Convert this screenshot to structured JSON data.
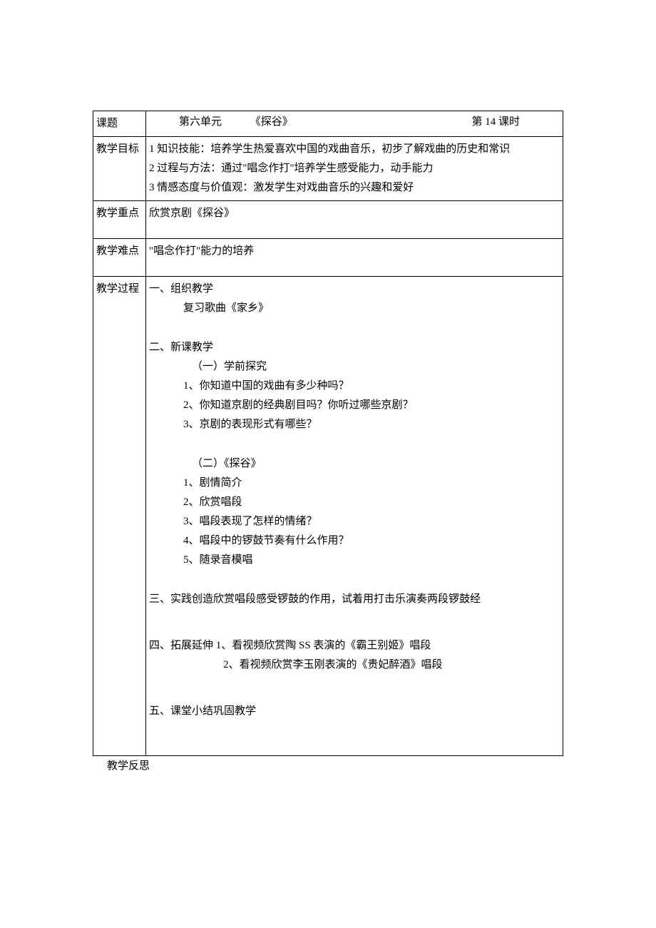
{
  "title_row": {
    "label": "课题",
    "unit": "第六单元",
    "piece": "《探谷》",
    "period": "第 14 课时"
  },
  "objectives": {
    "label": "教学目标",
    "o1": "1 知识技能：培养学生热爱喜欢中国的戏曲音乐，初步了解戏曲的历史和常识",
    "o2": "2 过程与方法：通过\"唱念作打\"培养学生感受能力，动手能力",
    "o3": "3 情感态度与价值观：激发学生对戏曲音乐的兴趣和爱好"
  },
  "key_point": {
    "label": "教学重点",
    "text": "欣赏京剧《探谷》"
  },
  "difficulty": {
    "label": "教学难点",
    "text": "\"唱念作打\"能力的培养"
  },
  "process": {
    "label": "教学过程",
    "s1": {
      "title": "一、组织教学",
      "l1": "复习歌曲《家乡》"
    },
    "s2": {
      "title": "二、新课教学",
      "subA_title": "（一）学前探究",
      "subA_1": "1、你知道中国的戏曲有多少种吗？",
      "subA_2": "2、你知道京剧的经典剧目吗？你听过哪些京剧？",
      "subA_3": "3、京剧的表现形式有哪些？",
      "subB_title": "（二）《探谷》",
      "subB_1": "1、剧情简介",
      "subB_2": "2、欣赏唱段",
      "subB_3": "3、唱段表现了怎样的情绪？",
      "subB_4": "4、唱段中的锣鼓节奏有什么作用？",
      "subB_5": "5、随录音模唱"
    },
    "s3": {
      "title": "三、实践创造欣赏唱段感受锣鼓的作用，试着用打击乐演奏两段锣鼓经"
    },
    "s4": {
      "line_a": "四、拓展延伸 1、看视频欣赏陶 SS 表演的《霸王别姬》唱段",
      "line_b": "2、看视频欣赏李玉刚表演的《贵妃醉酒》唱段"
    },
    "s5": {
      "title": "五、课堂小结巩固教学"
    }
  },
  "reflection": {
    "label": "教学反思"
  }
}
